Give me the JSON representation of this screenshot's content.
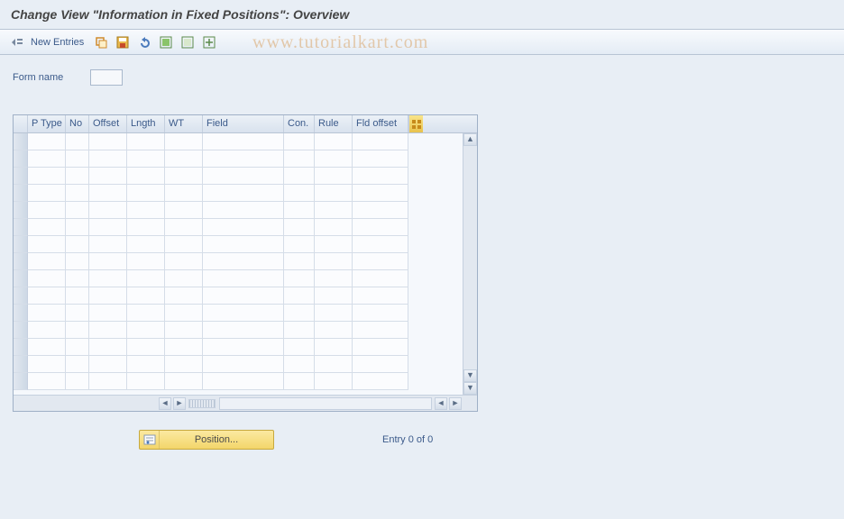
{
  "title": "Change View \"Information in Fixed Positions\": Overview",
  "watermark": "www.tutorialkart.com",
  "toolbar": {
    "new_entries_label": "New Entries"
  },
  "form": {
    "name_label": "Form name",
    "name_value": ""
  },
  "table": {
    "columns": [
      "P Type",
      "No",
      "Offset",
      "Lngth",
      "WT",
      "Field",
      "Con.",
      "Rule",
      "Fld offset"
    ],
    "rows": []
  },
  "footer": {
    "position_label": "Position...",
    "entry_text": "Entry 0 of 0"
  }
}
